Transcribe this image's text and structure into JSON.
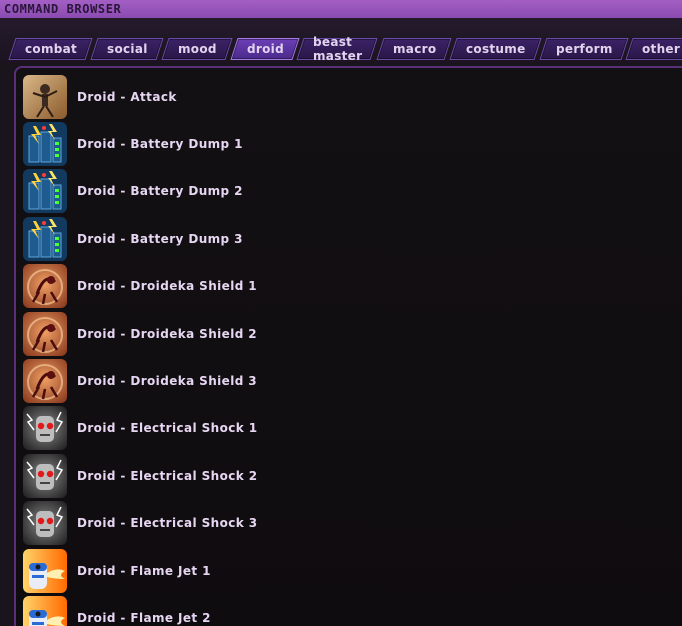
{
  "window": {
    "title": "COMMAND BROWSER"
  },
  "tabs": [
    {
      "label": "combat",
      "active": false
    },
    {
      "label": "social",
      "active": false
    },
    {
      "label": "mood",
      "active": false
    },
    {
      "label": "droid",
      "active": true
    },
    {
      "label": "beast master",
      "active": false
    },
    {
      "label": "macro",
      "active": false
    },
    {
      "label": "costume",
      "active": false
    },
    {
      "label": "perform",
      "active": false
    },
    {
      "label": "other",
      "active": false
    }
  ],
  "commands": [
    {
      "label": "Droid - Attack",
      "icon": "attack-droid-icon"
    },
    {
      "label": "Droid - Battery Dump 1",
      "icon": "battery-dump-icon"
    },
    {
      "label": "Droid - Battery Dump 2",
      "icon": "battery-dump-icon"
    },
    {
      "label": "Droid - Battery Dump 3",
      "icon": "battery-dump-icon"
    },
    {
      "label": "Droid - Droideka Shield 1",
      "icon": "droideka-shield-icon"
    },
    {
      "label": "Droid - Droideka Shield 2",
      "icon": "droideka-shield-icon"
    },
    {
      "label": "Droid - Droideka Shield 3",
      "icon": "droideka-shield-icon"
    },
    {
      "label": "Droid - Electrical Shock 1",
      "icon": "electrical-shock-icon"
    },
    {
      "label": "Droid - Electrical Shock 2",
      "icon": "electrical-shock-icon"
    },
    {
      "label": "Droid - Electrical Shock 3",
      "icon": "electrical-shock-icon"
    },
    {
      "label": "Droid - Flame Jet 1",
      "icon": "flame-jet-icon"
    },
    {
      "label": "Droid - Flame Jet 2",
      "icon": "flame-jet-icon"
    }
  ],
  "colors": {
    "titlebar": "#9a56bf",
    "tab_active": "#6c3fb8",
    "tab_inactive": "#2f1b55",
    "text": "#e7d6f2"
  }
}
